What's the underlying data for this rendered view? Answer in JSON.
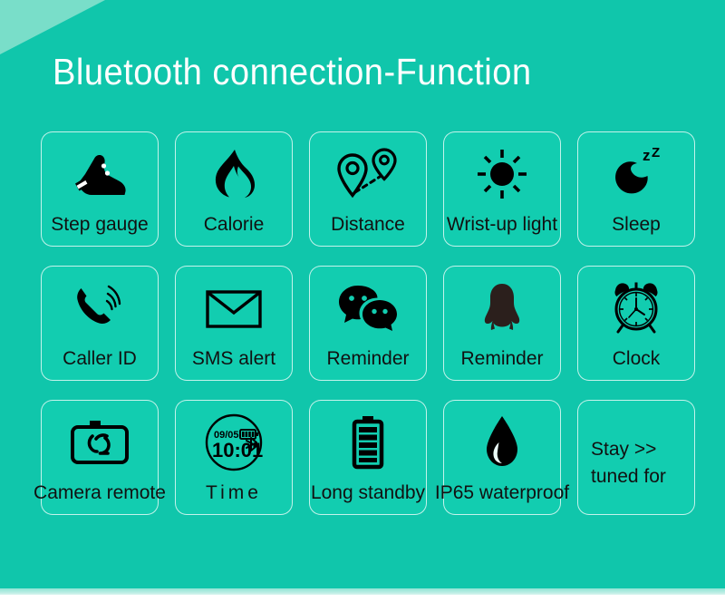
{
  "header": {
    "title": "Bluetooth connection-Function"
  },
  "colors": {
    "background": "#10c6ab",
    "card_background": "#12cdb0",
    "corner_accent": "#79dec9",
    "title_text": "#ffffff",
    "label_text": "#111111",
    "icon": "#000000",
    "card_border": "#ffffff"
  },
  "grid": {
    "rows": [
      {
        "cards": [
          {
            "label": "Step gauge",
            "icon": "shoe-icon"
          },
          {
            "label": "Calorie",
            "icon": "flame-icon"
          },
          {
            "label": "Distance",
            "icon": "map-pins-route-icon"
          },
          {
            "label": "Wrist-up light",
            "icon": "sun-icon"
          },
          {
            "label": "Sleep",
            "icon": "moon-zz-icon"
          }
        ]
      },
      {
        "cards": [
          {
            "label": "Caller ID",
            "icon": "phone-ringing-icon"
          },
          {
            "label": "SMS alert",
            "icon": "envelope-icon"
          },
          {
            "label": "Reminder",
            "icon": "wechat-bubbles-icon"
          },
          {
            "label": "Reminder",
            "icon": "qq-penguin-icon"
          },
          {
            "label": "Clock",
            "icon": "alarm-clock-icon"
          }
        ]
      },
      {
        "cards": [
          {
            "label": "Camera remote",
            "icon": "camera-timer-icon"
          },
          {
            "label": "Time",
            "icon": "watch-face-icon"
          },
          {
            "label": "Long standby",
            "icon": "battery-icon"
          },
          {
            "label": "IP65  waterproof",
            "icon": "water-drop-icon"
          },
          {
            "label": "Stay >> tuned for",
            "icon": "none"
          }
        ]
      }
    ]
  },
  "watch_face": {
    "date": "09/05",
    "time": "10:01",
    "battery_icon": "battery-icon",
    "bluetooth_icon": "bluetooth-icon"
  },
  "sleep_icon": {
    "zz_text": "zZ"
  }
}
